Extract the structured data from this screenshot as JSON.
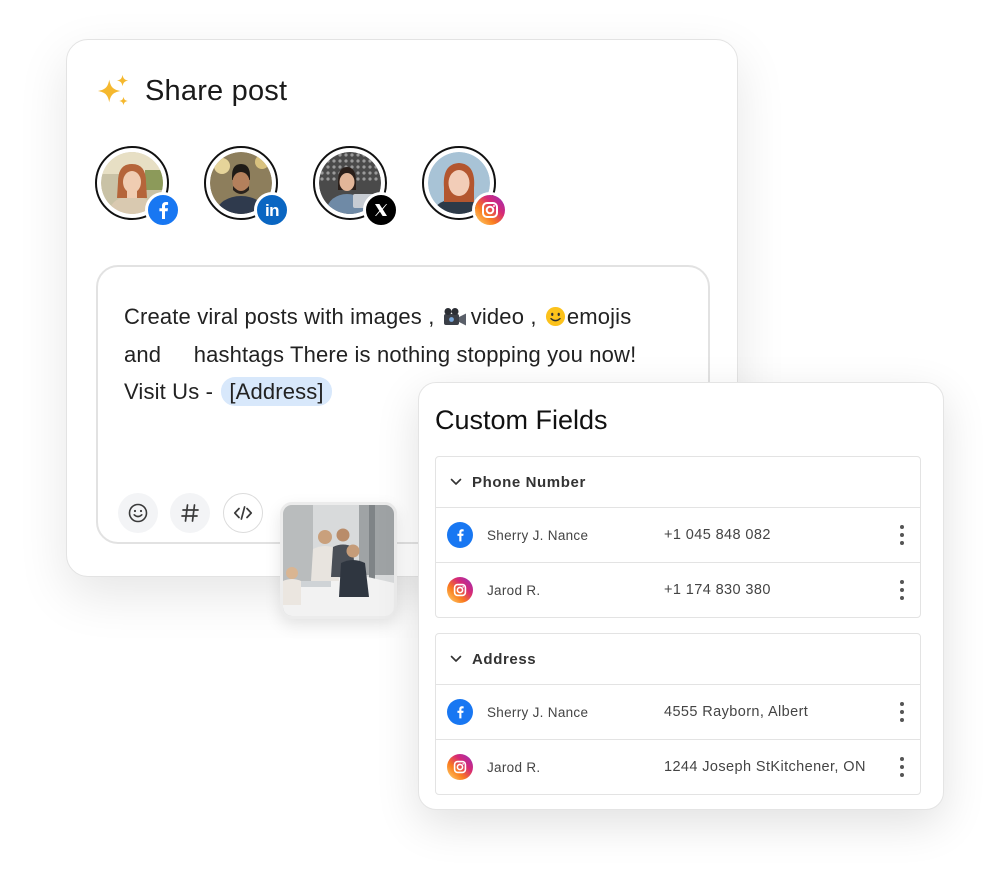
{
  "share": {
    "title": "Share post",
    "accounts": [
      {
        "network": "facebook",
        "icon": "facebook-icon"
      },
      {
        "network": "linkedin",
        "icon": "linkedin-icon"
      },
      {
        "network": "x",
        "icon": "x-icon"
      },
      {
        "network": "instagram",
        "icon": "instagram-icon"
      }
    ],
    "post_text": {
      "part1": "Create viral posts with images ,",
      "part2": "video ,",
      "part3": "emojis",
      "part4": "and",
      "part5": "hashtags There is nothing stopping you now!",
      "part6": "Visit Us -",
      "address_chip": "[Address]"
    },
    "tools": [
      "emoji-button",
      "hashtag-button",
      "code-button"
    ]
  },
  "custom_fields": {
    "title": "Custom Fields",
    "sections": [
      {
        "label": "Phone Number",
        "rows": [
          {
            "network": "facebook",
            "name": "Sherry J. Nance",
            "value": "+1 045 848 082"
          },
          {
            "network": "instagram",
            "name": "Jarod R.",
            "value": "+1 174 830 380"
          }
        ]
      },
      {
        "label": "Address",
        "rows": [
          {
            "network": "facebook",
            "name": "Sherry J. Nance",
            "value": "4555 Rayborn, Albert"
          },
          {
            "network": "instagram",
            "name": "Jarod R.",
            "value": "1244 Joseph StKitchener, ON"
          }
        ]
      }
    ]
  },
  "colors": {
    "facebook": "#1877f2",
    "linkedin": "#0a66c2",
    "x": "#000000",
    "instagram_gradient": [
      "#feda75",
      "#fa7e1e",
      "#d62976",
      "#962fbf"
    ],
    "sparkle": "#f5b82e",
    "address_chip": "#d8e8fb"
  }
}
